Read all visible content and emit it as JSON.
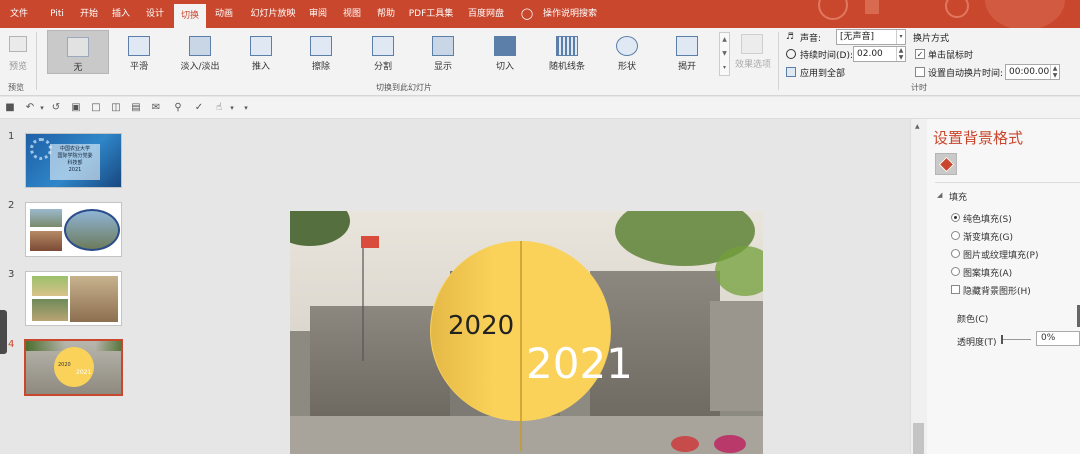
{
  "tabs": [
    {
      "label": "文件",
      "active": false
    },
    {
      "label": "Piti",
      "active": false
    },
    {
      "label": "开始",
      "active": false
    },
    {
      "label": "插入",
      "active": false
    },
    {
      "label": "设计",
      "active": false
    },
    {
      "label": "切换",
      "active": true
    },
    {
      "label": "动画",
      "active": false
    },
    {
      "label": "幻灯片放映",
      "active": false
    },
    {
      "label": "审阅",
      "active": false
    },
    {
      "label": "视图",
      "active": false
    },
    {
      "label": "帮助",
      "active": false
    },
    {
      "label": "PDF工具集",
      "active": false
    },
    {
      "label": "百度网盘",
      "active": false
    }
  ],
  "tell_me": {
    "label": "操作说明搜索",
    "icon": "lightbulb-icon"
  },
  "ribbon": {
    "preview": {
      "button_label": "预览",
      "group_label": "预览"
    },
    "transitions": [
      {
        "label": "无",
        "selected": true
      },
      {
        "label": "平滑"
      },
      {
        "label": "淡入/淡出"
      },
      {
        "label": "推入"
      },
      {
        "label": "擦除"
      },
      {
        "label": "分割"
      },
      {
        "label": "显示"
      },
      {
        "label": "切入"
      },
      {
        "label": "随机线条"
      },
      {
        "label": "形状"
      },
      {
        "label": "揭开"
      }
    ],
    "effect_options_label": "效果选项",
    "transitions_group_label": "切换到此幻灯片",
    "timing": {
      "sound_label": "声音:",
      "sound_value": "[无声音]",
      "duration_label": "持续时间(D):",
      "duration_value": "02.00",
      "apply_all_label": "应用到全部",
      "advance_title": "换片方式",
      "on_click_label": "单击鼠标时",
      "on_click_checked": true,
      "after_label": "设置自动换片时间:",
      "after_checked": false,
      "after_value": "00:00.00",
      "group_label": "计时"
    }
  },
  "slides": [
    {
      "number": "1",
      "title_lines": [
        "中国农业大学",
        "国际学院分党委",
        "科技部",
        "2021"
      ]
    },
    {
      "number": "2"
    },
    {
      "number": "3"
    },
    {
      "number": "4",
      "selected": true,
      "year_a": "2020",
      "year_b": "2021"
    }
  ],
  "main_slide": {
    "year_a": "2020",
    "year_b": "2021"
  },
  "format_pane": {
    "title": "设置背景格式",
    "section_label": "填充",
    "fill_options": [
      {
        "label": "纯色填充(S)",
        "selected": true
      },
      {
        "label": "渐变填充(G)",
        "selected": false
      },
      {
        "label": "图片或纹理填充(P)",
        "selected": false
      },
      {
        "label": "图案填充(A)",
        "selected": false
      }
    ],
    "hide_bg_label": "隐藏背景图形(H)",
    "color_label": "颜色(C)",
    "transparency_label": "透明度(T)",
    "transparency_value": "0%"
  },
  "colors": {
    "accent": "#c9472d",
    "sun": "#fad25a"
  }
}
